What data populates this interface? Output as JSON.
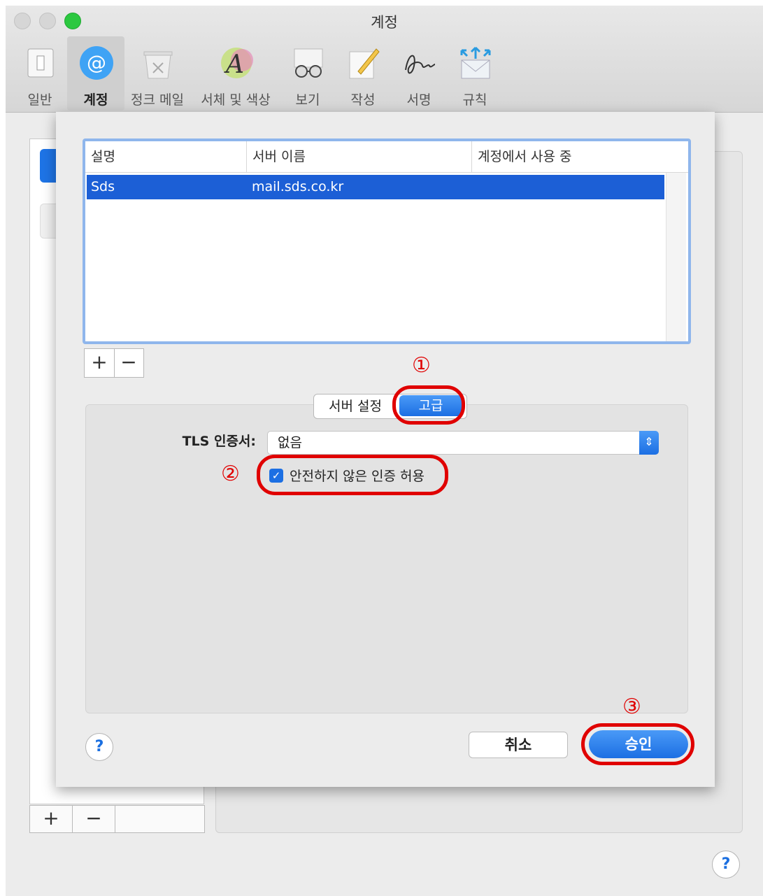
{
  "window": {
    "title": "계정",
    "toolbar": [
      {
        "label": "일반",
        "icon": "general-icon"
      },
      {
        "label": "계정",
        "icon": "at-icon"
      },
      {
        "label": "정크 메일",
        "icon": "trash-icon"
      },
      {
        "label": "서체 및 색상",
        "icon": "font-icon"
      },
      {
        "label": "보기",
        "icon": "glasses-icon"
      },
      {
        "label": "작성",
        "icon": "pencil-icon"
      },
      {
        "label": "서명",
        "icon": "signature-icon"
      },
      {
        "label": "규칙",
        "icon": "rules-icon"
      }
    ],
    "selected_tab": "계정"
  },
  "background": {
    "add_label": "+",
    "remove_label": "−",
    "help_label": "?"
  },
  "sheet": {
    "columns": [
      "설명",
      "서버 이름",
      "계정에서 사용 중"
    ],
    "rows": [
      {
        "description": "Sds",
        "server": "mail.sds.co.kr",
        "in_use": ""
      }
    ],
    "add_label": "+",
    "remove_label": "−",
    "tabs": {
      "server_settings": "서버 설정",
      "advanced": "고급",
      "selected": "고급"
    },
    "tls_label": "TLS 인증서:",
    "tls_value": "없음",
    "allow_insecure_label": "안전하지 않은 인증 허용",
    "allow_insecure_checked": true,
    "help_label": "?",
    "cancel_label": "취소",
    "ok_label": "승인"
  },
  "annotations": [
    "①",
    "②",
    "③"
  ],
  "colors": {
    "accent": "#1c6fe3",
    "selection": "#1c5fd6",
    "annotation": "#e00000"
  }
}
